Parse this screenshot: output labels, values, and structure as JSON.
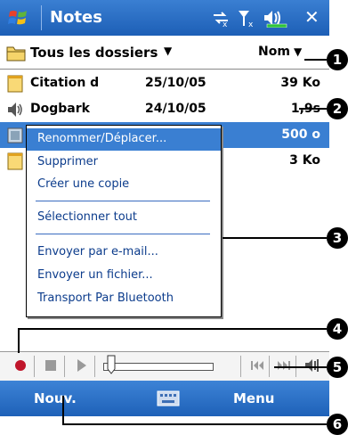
{
  "titlebar": {
    "app_title": "Notes",
    "icons": [
      "windows-start-icon",
      "connectivity-icon",
      "signal-off-icon",
      "volume-icon",
      "close-icon"
    ],
    "close_label": "✕"
  },
  "header": {
    "folder_label": "Tous les dossiers",
    "sort_label": "Nom"
  },
  "list": {
    "rows": [
      {
        "name": "Citation d",
        "date": "25/10/05",
        "size": "39 Ko",
        "icon": "note-file-icon"
      },
      {
        "name": "Dogbark",
        "date": "24/10/05",
        "size": "1,9s",
        "icon": "recording-icon"
      },
      {
        "name": "",
        "date": "",
        "size": "500 o",
        "icon": "image-file-icon"
      },
      {
        "name": "",
        "date": "",
        "size": "3 Ko",
        "icon": "note-file-icon"
      }
    ],
    "row3_date_partial": "05",
    "row4_date_partial": "05"
  },
  "context_menu": {
    "items": [
      "Renommer/Déplacer...",
      "Supprimer",
      "Créer une copie",
      "Sélectionner tout",
      "Envoyer par e-mail...",
      "Envoyer un fichier...",
      "Transport Par Bluetooth"
    ]
  },
  "mediabar": {
    "icons": [
      "record-icon",
      "stop-icon",
      "play-icon",
      "playback-slider",
      "skip-back-icon",
      "skip-forward-icon",
      "speaker-icon"
    ],
    "position": 0.0
  },
  "bottombar": {
    "left_label": "Nouv.",
    "right_label": "Menu"
  },
  "callouts": [
    "1",
    "2",
    "3",
    "4",
    "5",
    "6"
  ],
  "colors": {
    "titlebar": "#1d5fb6",
    "selection": "#3a7fd2",
    "menu_text": "#0c3c8c"
  }
}
